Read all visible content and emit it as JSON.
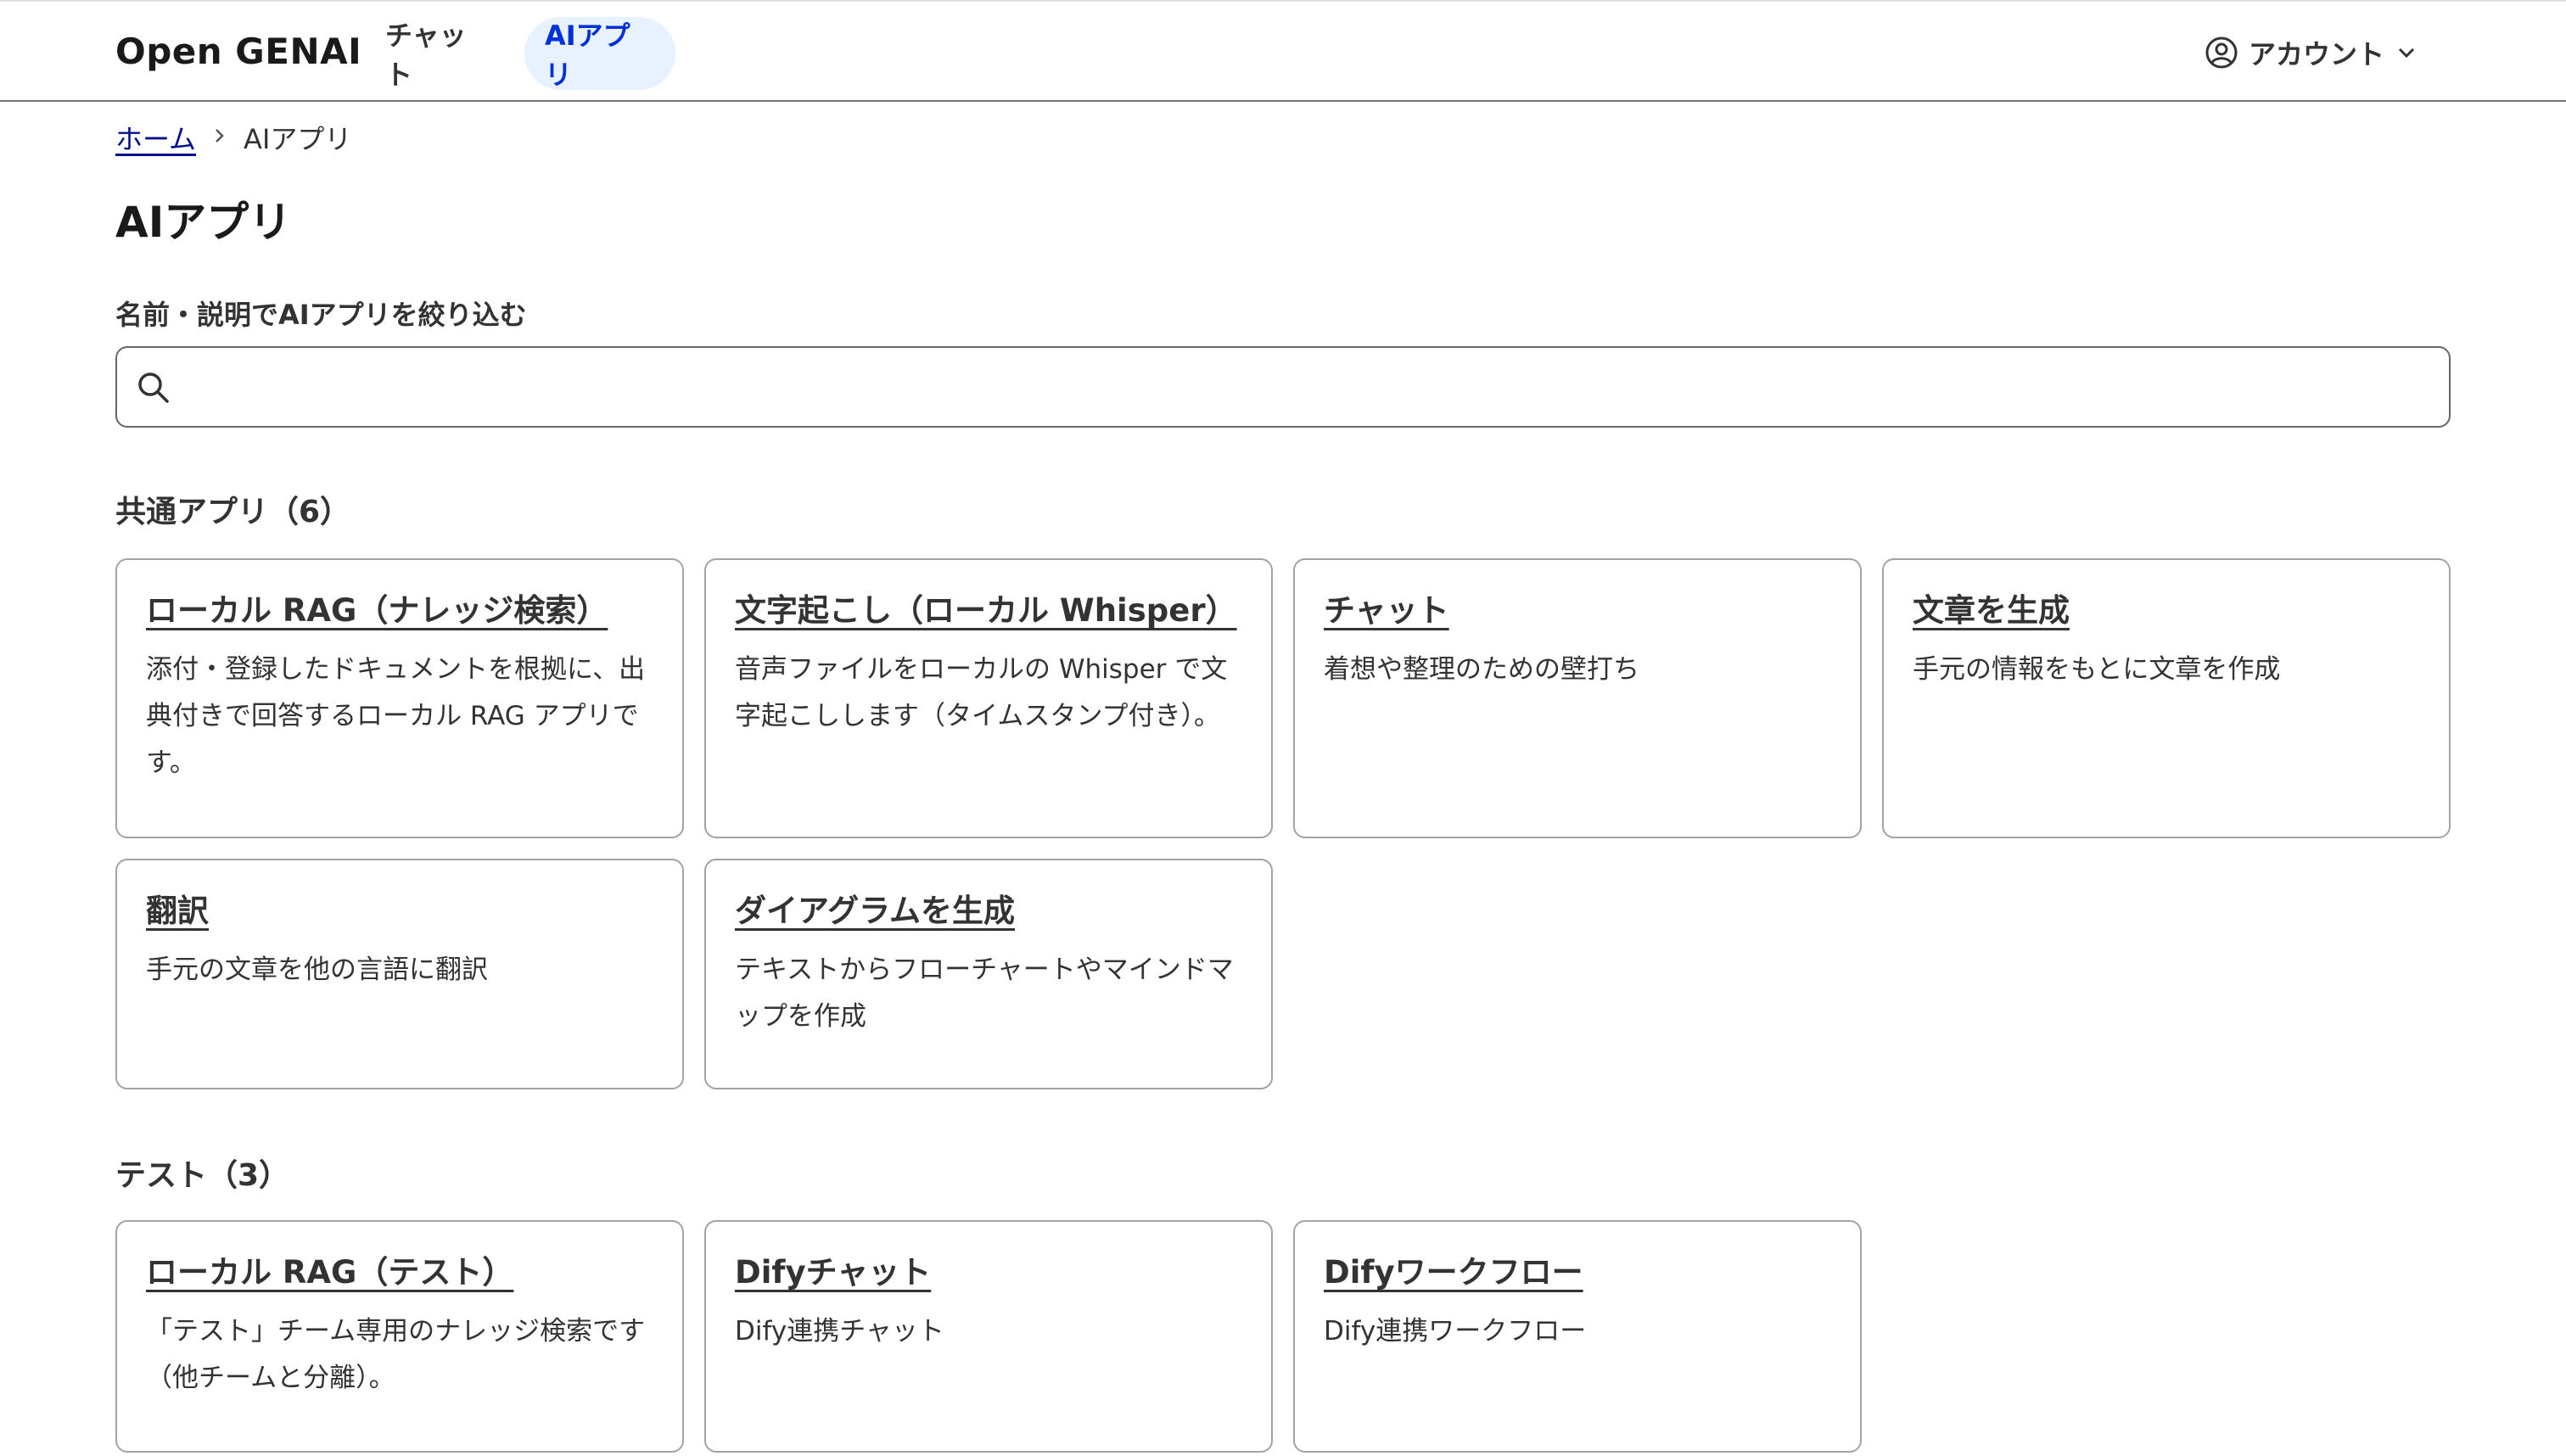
{
  "header": {
    "logo": "Open GENAI",
    "nav": [
      {
        "label": "チャット"
      },
      {
        "label": "AIアプリ",
        "active": true
      }
    ],
    "account_label": "アカウント",
    "account_icon": "user-circle-icon",
    "accent_color": "#0031d8",
    "active_bg": "#e8f1fe"
  },
  "breadcrumb": {
    "home": "ホーム",
    "current": "AIアプリ"
  },
  "page": {
    "title": "AIアプリ",
    "filter_label": "名前・説明でAIアプリを絞り込む",
    "search_value": "",
    "search_placeholder": ""
  },
  "sections": [
    {
      "title": "共通アプリ（6）",
      "cards": [
        {
          "title": "ローカル RAG（ナレッジ検索）",
          "desc": "添付・登録したドキュメントを根拠に、出典付きで回答するローカル RAG アプリです。"
        },
        {
          "title": "文字起こし（ローカル Whisper）",
          "desc": "音声ファイルをローカルの Whisper で文字起こしします（タイムスタンプ付き）。"
        },
        {
          "title": "チャット",
          "desc": "着想や整理のための壁打ち"
        },
        {
          "title": "文章を生成",
          "desc": "手元の情報をもとに文章を作成"
        },
        {
          "title": "翻訳",
          "desc": "手元の文章を他の言語に翻訳"
        },
        {
          "title": "ダイアグラムを生成",
          "desc": "テキストからフローチャートやマインドマップを作成"
        }
      ]
    },
    {
      "title": "テスト（3）",
      "cards": [
        {
          "title": "ローカル RAG（テスト）",
          "desc": "「テスト」チーム専用のナレッジ検索です（他チームと分離）。"
        },
        {
          "title": "Difyチャット",
          "desc": "Dify連携チャット"
        },
        {
          "title": "Difyワークフロー",
          "desc": "Dify連携ワークフロー"
        }
      ]
    }
  ]
}
